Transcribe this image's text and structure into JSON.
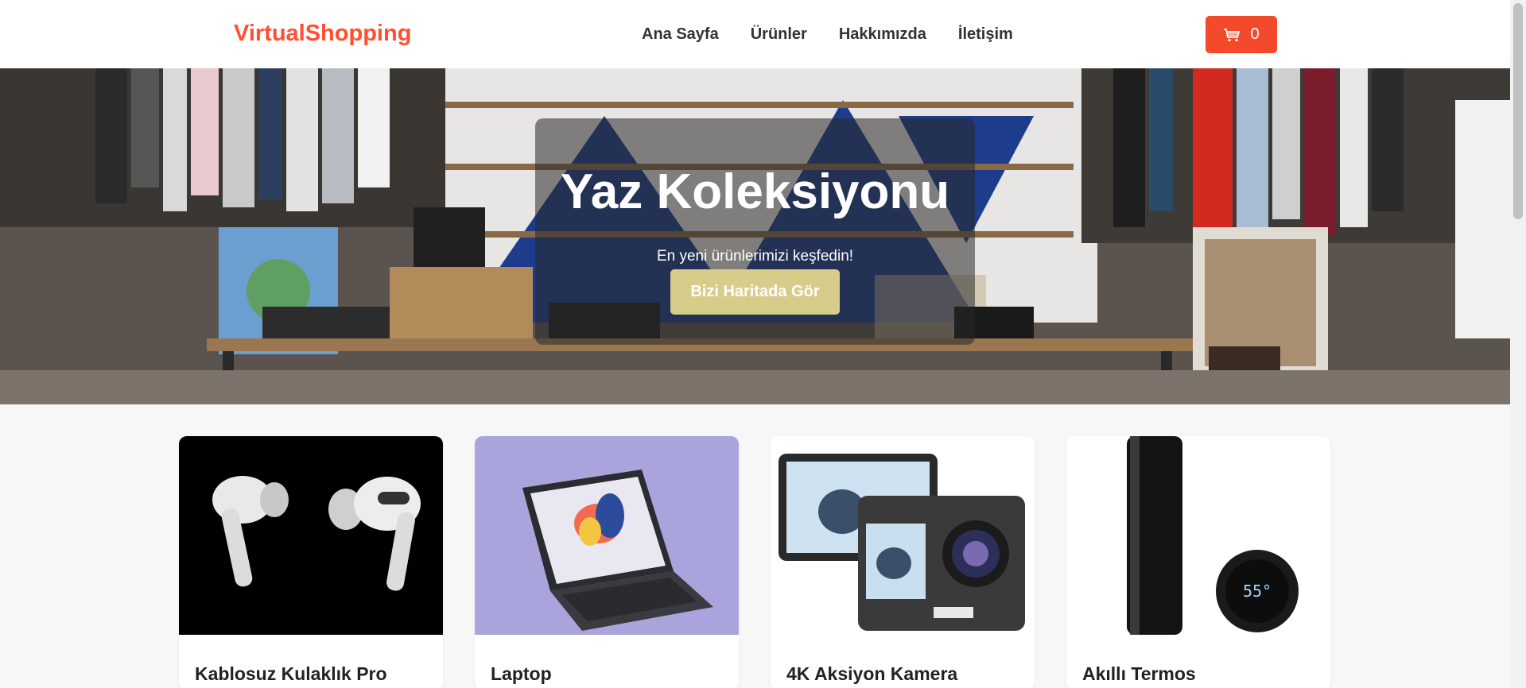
{
  "header": {
    "logo": "VirtualShopping",
    "nav": [
      "Ana Sayfa",
      "Ürünler",
      "Hakkımızda",
      "İletişim"
    ],
    "cart_count": "0",
    "cart_icon": "cart-icon"
  },
  "hero": {
    "title": "Yaz Koleksiyonu",
    "subtitle": "En yeni ürünlerimizi keşfedin!",
    "button": "Bizi Haritada Gör"
  },
  "products": [
    {
      "name": "Kablosuz Kulaklık Pro",
      "image": "earbuds-photo"
    },
    {
      "name": "Laptop",
      "image": "laptop-photo"
    },
    {
      "name": "4K Aksiyon Kamera",
      "image": "action-camera-photo"
    },
    {
      "name": "Akıllı Termos",
      "image": "thermos-photo"
    }
  ],
  "colors": {
    "brand": "#ff4f32",
    "cart_button": "#f44a2c",
    "hero_button": "#d8cc8a"
  }
}
